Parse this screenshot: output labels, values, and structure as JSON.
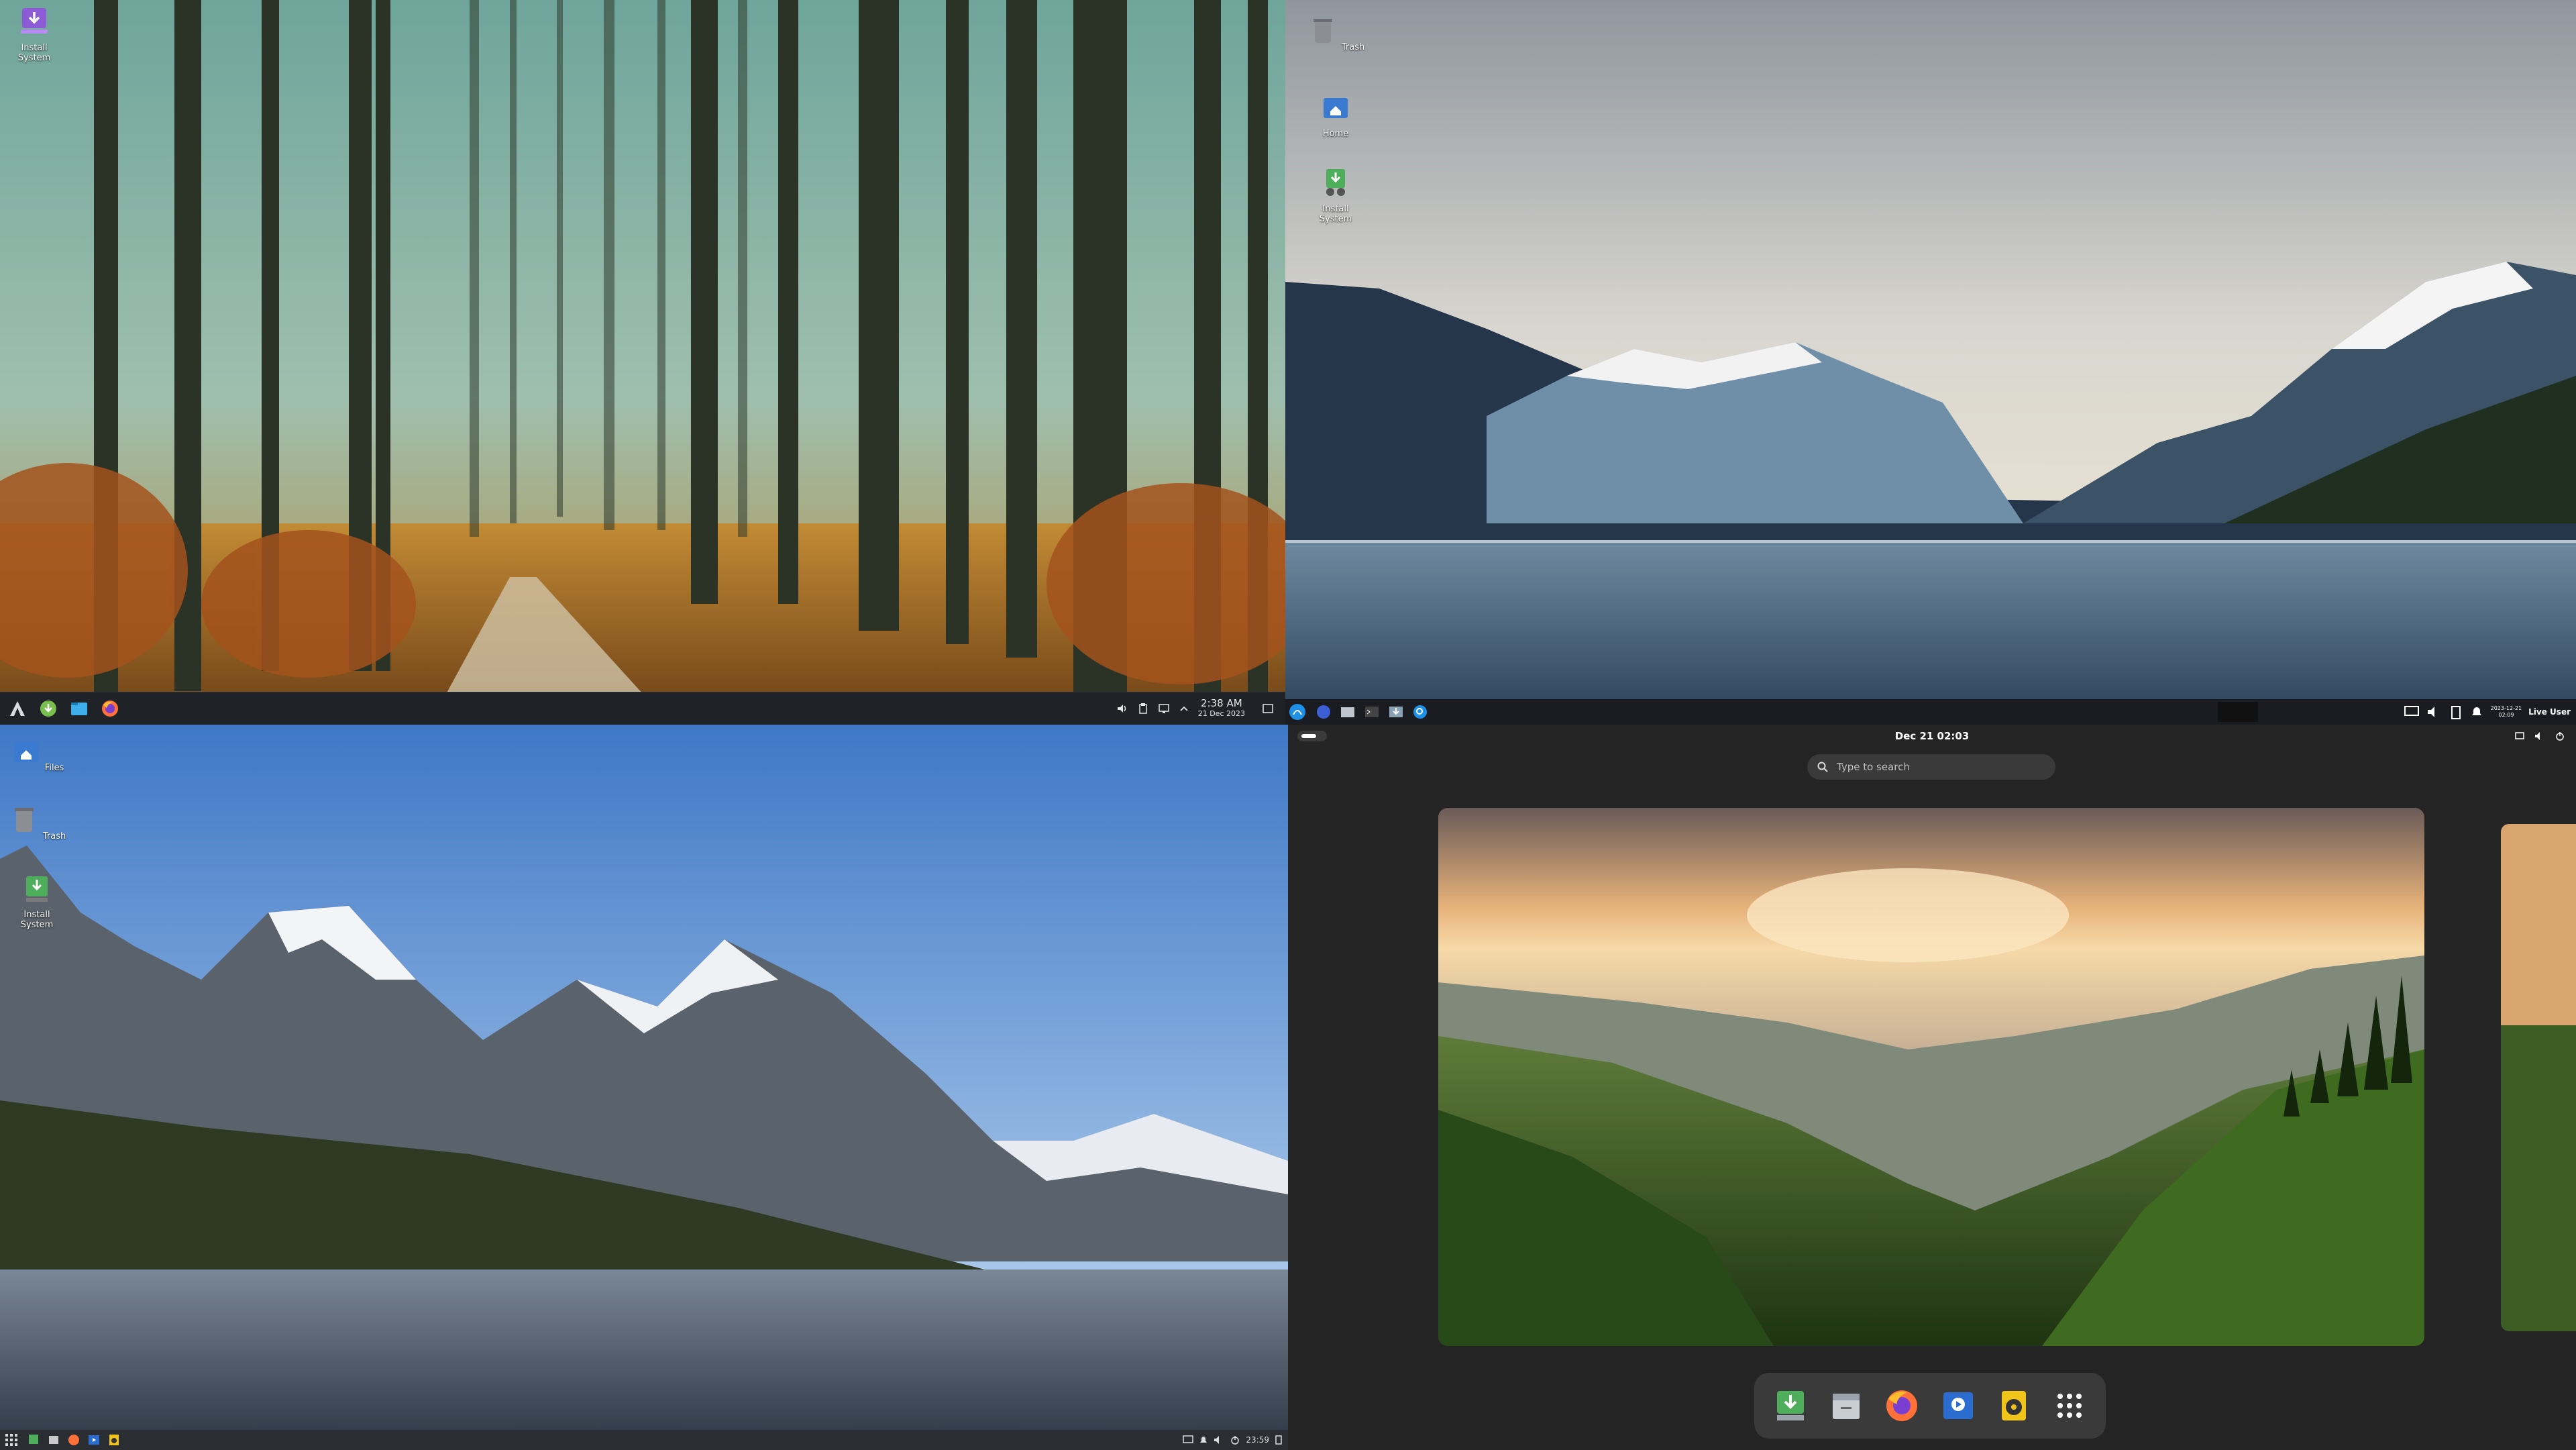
{
  "q1": {
    "desktop_icons": [
      {
        "label": "Install System",
        "icon": "install-icon"
      }
    ],
    "panel": {
      "launchers": [
        "app-launcher-icon",
        "discover-icon",
        "files-icon",
        "firefox-icon"
      ],
      "clock_time": "2:38 AM",
      "clock_date": "21 Dec 2023"
    }
  },
  "q2": {
    "desktop_icons": [
      {
        "label": "Trash",
        "icon": "trash-icon"
      },
      {
        "label": "Home",
        "icon": "home-folder-icon"
      },
      {
        "label": "Install System",
        "icon": "install-icon"
      }
    ],
    "panel": {
      "clock_date": "2023-12-21",
      "clock_time": "02:09",
      "user": "Live User"
    }
  },
  "q3": {
    "desktop_icons": [
      {
        "label": "Files",
        "icon": "home-folder-icon"
      },
      {
        "label": "Trash",
        "icon": "trash-icon"
      },
      {
        "label": "Install System",
        "icon": "install-icon"
      }
    ],
    "panel": {
      "clock_time": "23:59"
    }
  },
  "q4": {
    "topbar": {
      "datetime": "Dec 21  02:03"
    },
    "search": {
      "placeholder": "Type to search"
    },
    "dock": [
      "install-icon",
      "files-icon",
      "firefox-icon",
      "video-player-icon",
      "music-icon",
      "show-apps-icon"
    ]
  },
  "colors": {
    "kde_panel": "#1f2227",
    "gnome_bg": "#242424",
    "accent_blue": "#3daee9"
  }
}
